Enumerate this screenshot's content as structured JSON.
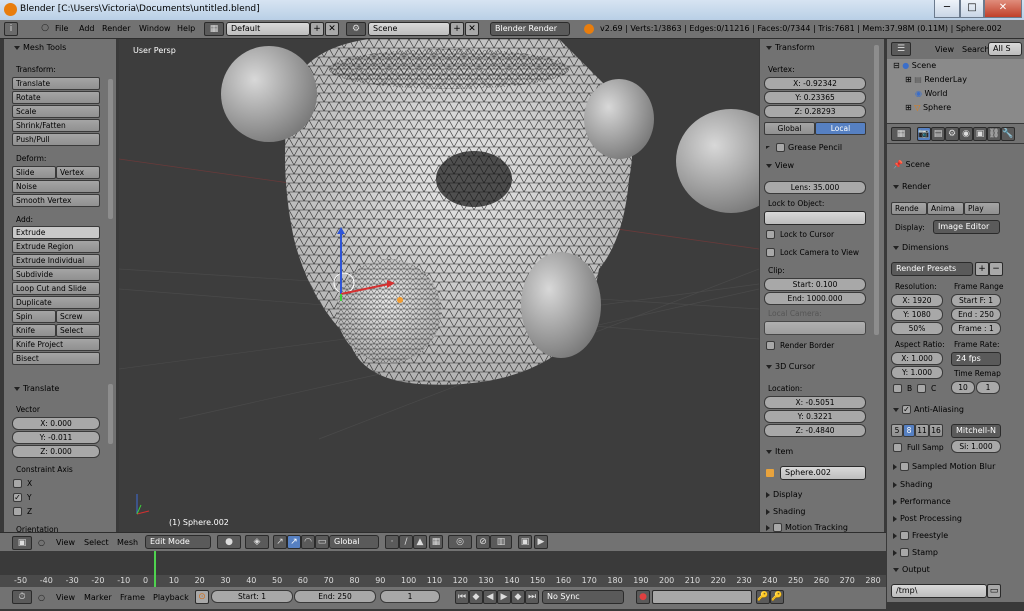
{
  "window": {
    "title": "Blender [C:\\Users\\Victoria\\Documents\\untitled.blend]",
    "minimize": "─",
    "maximize": "□",
    "close": "✕"
  },
  "menubar": {
    "items": [
      "File",
      "Add",
      "Render",
      "Window",
      "Help"
    ],
    "layout": "Default",
    "scene": "Scene",
    "engine": "Blender Render",
    "stats": "v2.69 | Verts:1/3863 | Edges:0/11216 | Faces:0/7344 | Tris:7681 | Mem:37.98M (0.11M) | Sphere.002"
  },
  "left_panel": {
    "header": "Mesh Tools",
    "transform_label": "Transform:",
    "transform_buttons": [
      "Translate",
      "Rotate",
      "Scale",
      "Shrink/Fatten",
      "Push/Pull"
    ],
    "deform_label": "Deform:",
    "slide_edge": "Slide Edge",
    "vertex": "Vertex",
    "noise": "Noise",
    "smooth_vertex": "Smooth Vertex",
    "add_label": "Add:",
    "extrude": "Extrude",
    "extrude_region": "Extrude Region",
    "extrude_individual": "Extrude Individual",
    "subdivide": "Subdivide",
    "loop_cut": "Loop Cut and Slide",
    "duplicate": "Duplicate",
    "spin": "Spin",
    "screw": "Screw",
    "knife": "Knife",
    "select": "Select",
    "knife_project": "Knife Project",
    "bisect": "Bisect",
    "translate_header": "Translate",
    "vector_label": "Vector",
    "vx": "X: 0.000",
    "vy": "Y: -0.011",
    "vz": "Z: 0.000",
    "constraint_label": "Constraint Axis",
    "cx": "X",
    "cy": "Y",
    "cz": "Z",
    "orientation": "Orientation"
  },
  "viewport": {
    "label": "User Persp",
    "object": "(1) Sphere.002"
  },
  "right_panel": {
    "transform": "Transform",
    "vertex_label": "Vertex:",
    "vx": "X: -0.92342",
    "vy": "Y: 0.23365",
    "vz": "Z: 0.28293",
    "global": "Global",
    "local": "Local",
    "grease_pencil": "Grease Pencil",
    "view": "View",
    "lens": "Lens: 35.000",
    "lock_to_object": "Lock to Object:",
    "lock_to_cursor": "Lock to Cursor",
    "lock_camera": "Lock Camera to View",
    "clip": "Clip:",
    "clip_start": "Start: 0.100",
    "clip_end": "End: 1000.000",
    "local_camera": "Local Camera:",
    "render_border": "Render Border",
    "cursor": "3D Cursor",
    "location": "Location:",
    "cx": "X: -0.5051",
    "cy": "Y: 0.3221",
    "cz": "Z: -0.4840",
    "item": "Item",
    "item_name": "Sphere.002",
    "display": "Display",
    "shading": "Shading",
    "motion_tracking": "Motion Tracking"
  },
  "outliner": {
    "view": "View",
    "search": "Search",
    "all": "All S",
    "scene": "Scene",
    "render_layers": "RenderLay",
    "world": "World",
    "sphere": "Sphere"
  },
  "properties": {
    "scene": "Scene",
    "render": "Render",
    "render_btn": "Rende",
    "anim_btn": "Anima",
    "play_btn": "Play",
    "display_label": "Display:",
    "display_value": "Image Editor",
    "dimensions": "Dimensions",
    "render_presets": "Render Presets",
    "resolution": "Resolution:",
    "frame_range": "Frame Range",
    "res_x": "X: 1920",
    "res_y": "Y: 1080",
    "res_pct": "50%",
    "start_f": "Start F: 1",
    "end": "End : 250",
    "frame": "Frame : 1",
    "aspect": "Aspect Ratio:",
    "frame_rate": "Frame Rate:",
    "asp_x": "X: 1.000",
    "asp_y": "Y: 1.000",
    "fps": "24 fps",
    "time_remap": "Time Remap",
    "b": "B",
    "c": "C",
    "remap_old": "10",
    "remap_new": "1",
    "anti_aliasing": "Anti-Aliasing",
    "aa5": "5",
    "aa8": "8",
    "aa11": "11",
    "aa16": "16",
    "filter": "Mitchell-N",
    "full_sample": "Full Samp",
    "size": "Si: 1.000",
    "motion_blur": "Sampled Motion Blur",
    "shading": "Shading",
    "performance": "Performance",
    "post_processing": "Post Processing",
    "freestyle": "Freestyle",
    "stamp": "Stamp",
    "output": "Output",
    "output_path": "/tmp\\"
  },
  "view_header": {
    "view": "View",
    "select": "Select",
    "mesh": "Mesh",
    "mode": "Edit Mode",
    "orientation": "Global"
  },
  "timeline": {
    "ticks": [
      "-50",
      "-40",
      "-30",
      "-20",
      "-10",
      "0",
      "10",
      "20",
      "30",
      "40",
      "50",
      "60",
      "70",
      "80",
      "90",
      "100",
      "110",
      "120",
      "130",
      "140",
      "150",
      "160",
      "170",
      "180",
      "190",
      "200",
      "210",
      "220",
      "230",
      "240",
      "250",
      "260",
      "270",
      "280"
    ],
    "current_frame": 1
  },
  "timeline_header": {
    "view": "View",
    "marker": "Marker",
    "frame": "Frame",
    "playback": "Playback",
    "start": "Start: 1",
    "end": "End: 250",
    "current": "1",
    "sync": "No Sync"
  }
}
